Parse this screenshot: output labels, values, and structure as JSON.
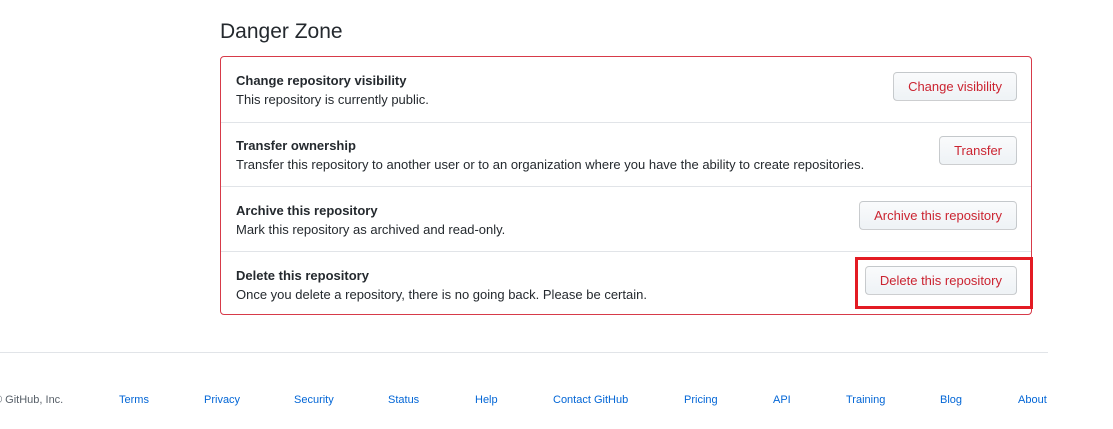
{
  "danger_zone": {
    "title": "Danger Zone",
    "rows": [
      {
        "title": "Change repository visibility",
        "description": "This repository is currently public.",
        "button": "Change visibility"
      },
      {
        "title": "Transfer ownership",
        "description": "Transfer this repository to another user or to an organization where you have the ability to create repositories.",
        "button": "Transfer"
      },
      {
        "title": "Archive this repository",
        "description": "Mark this repository as archived and read-only.",
        "button": "Archive this repository"
      },
      {
        "title": "Delete this repository",
        "description": "Once you delete a repository, there is no going back. Please be certain.",
        "button": "Delete this repository"
      }
    ]
  },
  "footer": {
    "copyright": "© GitHub, Inc.",
    "links": [
      "Terms",
      "Privacy",
      "Security",
      "Status",
      "Help",
      "Contact GitHub",
      "Pricing",
      "API",
      "Training",
      "Blog",
      "About"
    ]
  },
  "colors": {
    "danger_border": "#d73a49",
    "danger_text": "#cb2431",
    "highlight": "#e31b23",
    "link": "#0366d6"
  }
}
